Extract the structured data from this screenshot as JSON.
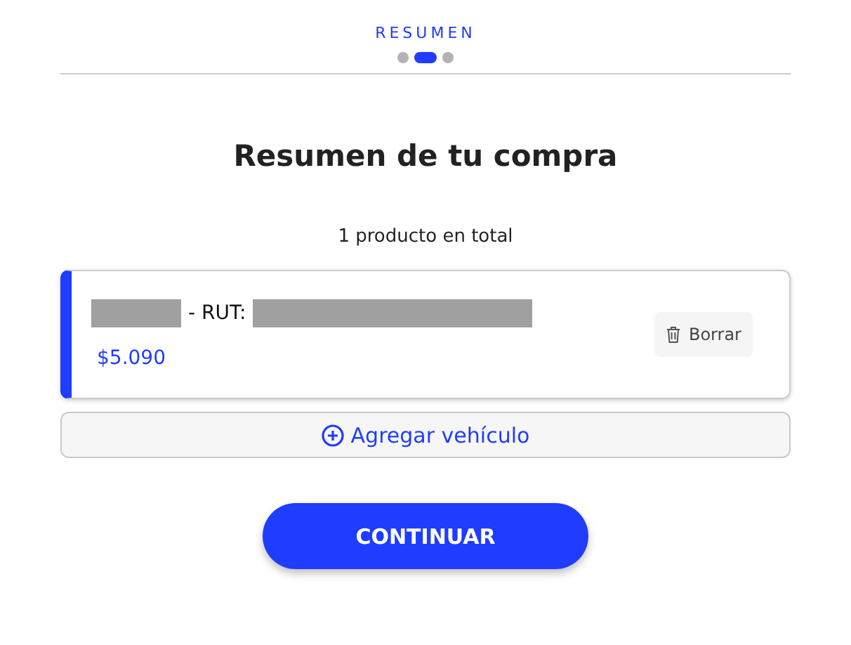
{
  "stepper": {
    "label": "RESUMEN",
    "steps": [
      {
        "selected": false
      },
      {
        "selected": true
      },
      {
        "selected": false
      }
    ]
  },
  "title": "Resumen de tu compra",
  "count": "1 producto en total",
  "products": [
    {
      "rut_label": "- RUT:",
      "price": "$5.090",
      "delete": "Borrar"
    }
  ],
  "add_button": "Agregar vehículo",
  "continue_button": "CONTINUAR"
}
